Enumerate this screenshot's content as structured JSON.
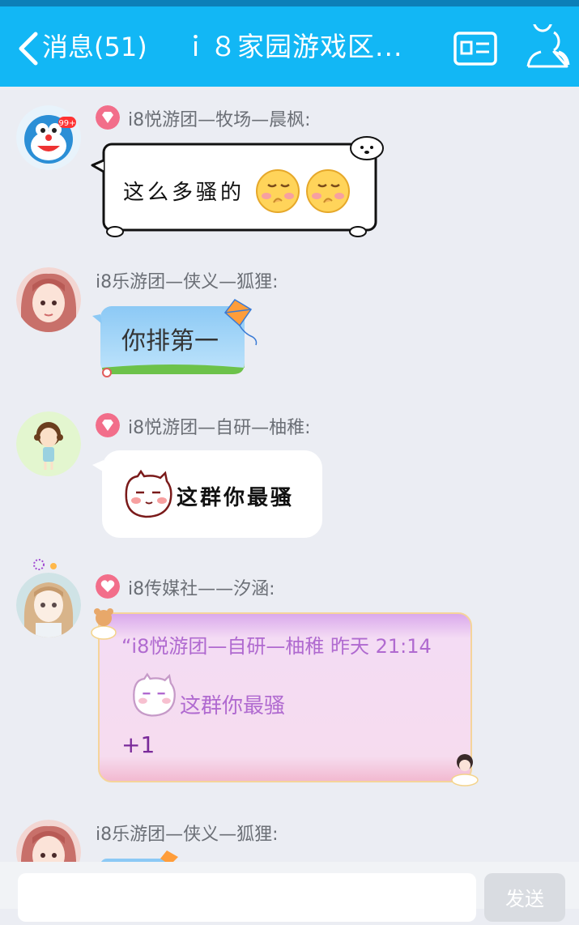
{
  "header": {
    "back_label": "消息(51)",
    "title": "ｉ８家园游戏区...",
    "colors": {
      "bar": "#12b7f5",
      "status": "#0c7fb8"
    }
  },
  "messages": [
    {
      "sender": "i8悦游团—牧场—晨枫:",
      "text": "这么多骚的",
      "badge": "diamond",
      "avatar": "doraemon-99plus"
    },
    {
      "sender": "i8乐游团—侠义—狐狸:",
      "text": "你排第一",
      "avatar": "pink-hair-girl"
    },
    {
      "sender": "i8悦游团—自研—柚稚:",
      "text": "这群你最骚",
      "badge": "diamond",
      "avatar": "cartoon-girl"
    },
    {
      "sender": "i8传媒社——汐涵:",
      "quote": "“i8悦游团—自研—柚稚 昨天 21:14",
      "quote_text": "这群你最骚",
      "reply": "+1",
      "badge": "heart",
      "avatar": "anime-girl"
    },
    {
      "sender": "i8乐游团—侠义—狐狸:",
      "avatar": "pink-hair-girl"
    }
  ],
  "input": {
    "send_label": "发送"
  }
}
